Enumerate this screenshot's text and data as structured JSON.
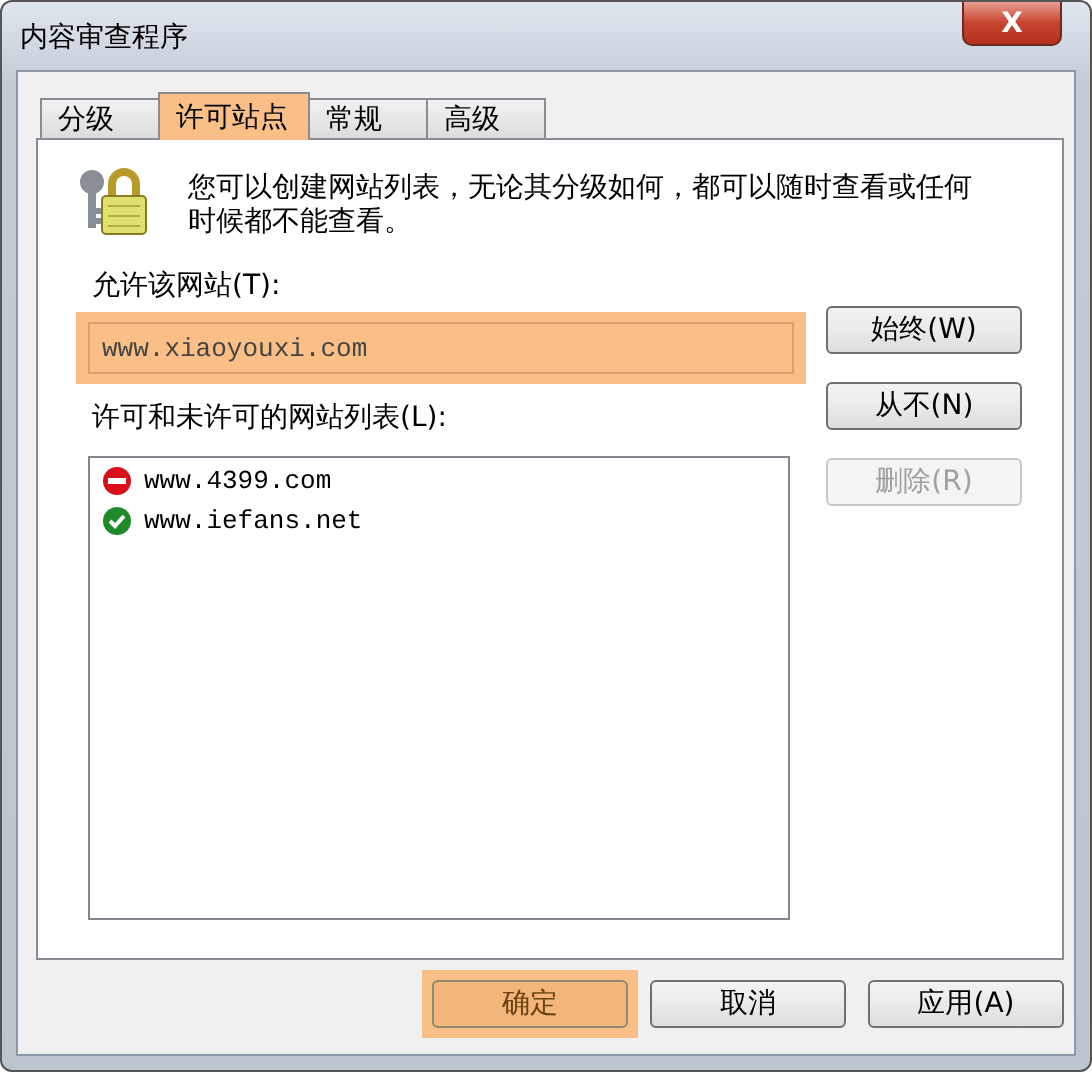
{
  "window": {
    "title": "内容审查程序",
    "close": "X"
  },
  "tabs": [
    {
      "label": "分级",
      "selected": false,
      "highlighted": false
    },
    {
      "label": "许可站点",
      "selected": true,
      "highlighted": true
    },
    {
      "label": "常规",
      "selected": false,
      "highlighted": false
    },
    {
      "label": "高级",
      "selected": false,
      "highlighted": false
    }
  ],
  "description": "您可以创建网站列表，无论其分级如何，都可以随时查看或任何时候都不能查看。",
  "site_field": {
    "label": "允许该网站(T):",
    "value": "www.xiaoyouxi.com",
    "highlighted": true
  },
  "side_buttons": [
    {
      "label": "始终(W)",
      "disabled": false
    },
    {
      "label": "从不(N)",
      "disabled": false
    },
    {
      "label": "删除(R)",
      "disabled": true
    }
  ],
  "list": {
    "label": "许可和未许可的网站列表(L):",
    "items": [
      {
        "site": "www.4399.com",
        "kind": "blocked"
      },
      {
        "site": "www.iefans.net",
        "kind": "allowed"
      }
    ]
  },
  "footer_buttons": [
    {
      "label": "确定",
      "highlighted": true
    },
    {
      "label": "取消",
      "highlighted": false
    },
    {
      "label": "应用(A)",
      "highlighted": false
    }
  ]
}
